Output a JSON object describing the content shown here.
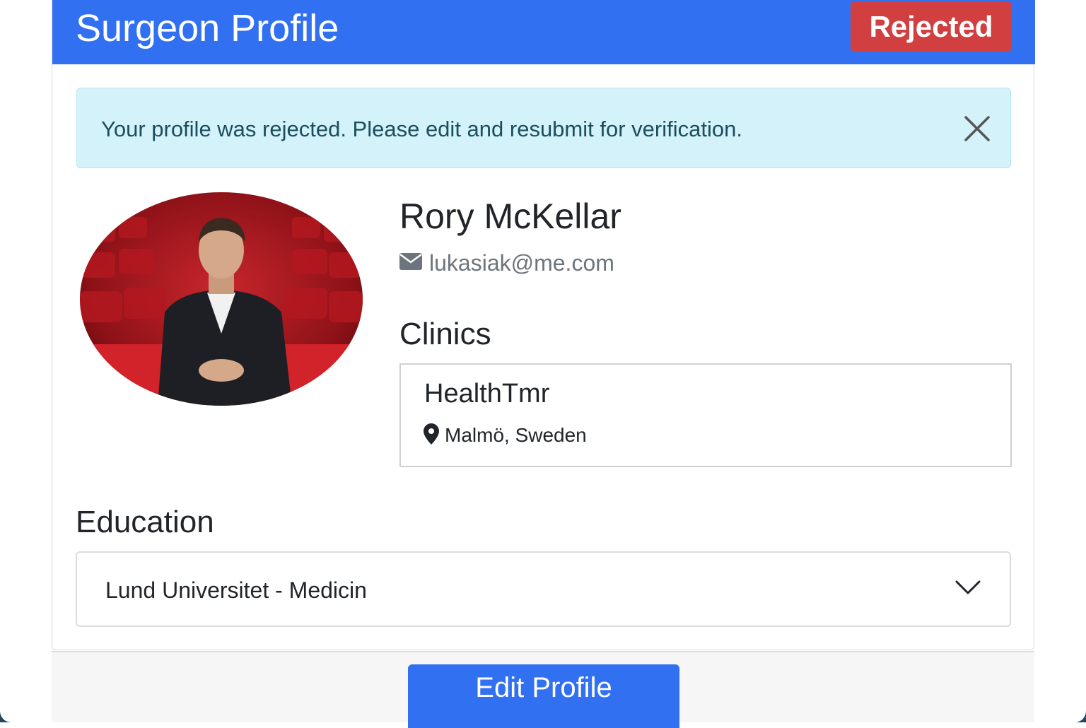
{
  "header": {
    "title": "Surgeon Profile",
    "status": "Rejected",
    "accent_color": "#3170f1",
    "status_color": "#d23f41"
  },
  "alert": {
    "message": "Your profile was rejected. Please edit and resubmit for verification.",
    "close_icon": "close-icon"
  },
  "profile": {
    "name": "Rory McKellar",
    "email": "lukasiak@me.com",
    "email_icon": "envelope-icon"
  },
  "clinics": {
    "heading": "Clinics",
    "items": [
      {
        "name": "HealthTmr",
        "location": "Malmö, Sweden",
        "icon": "map-pin-icon"
      }
    ]
  },
  "education": {
    "heading": "Education",
    "items": [
      {
        "label": "Lund Universitet - Medicin",
        "icon": "chevron-down-icon"
      }
    ]
  },
  "footer": {
    "edit_label": "Edit Profile"
  }
}
